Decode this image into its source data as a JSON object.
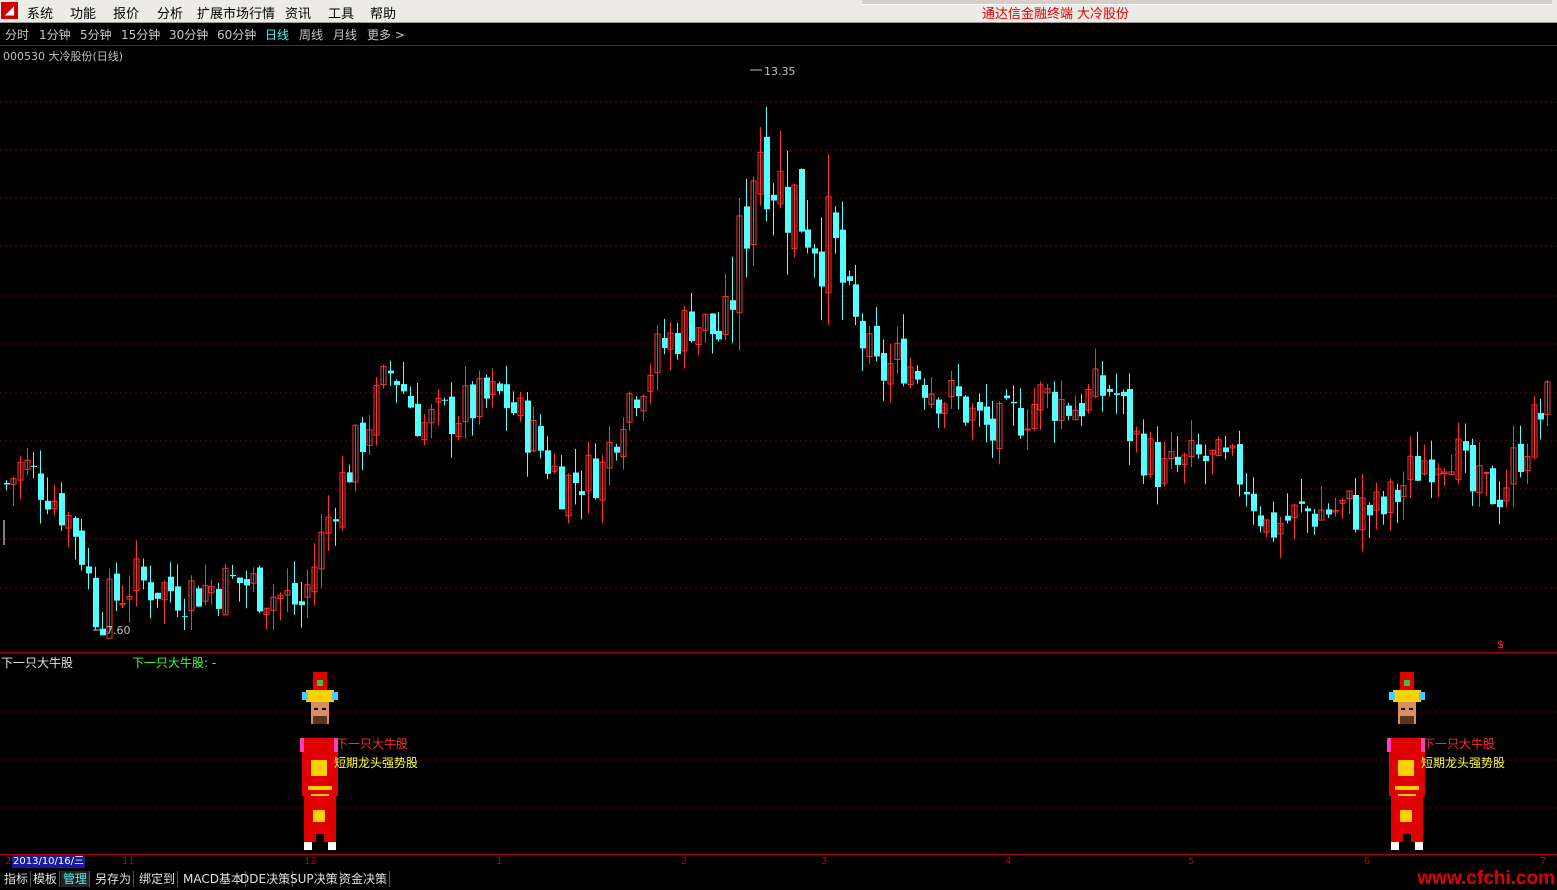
{
  "menu": {
    "items": [
      "系统",
      "功能",
      "报价",
      "分析",
      "扩展市场行情",
      "资讯",
      "工具",
      "帮助"
    ],
    "brand": "通达信金融终端",
    "stock_name": "大冷股份"
  },
  "periods": {
    "items": [
      "分时",
      "1分钟",
      "5分钟",
      "15分钟",
      "30分钟",
      "60分钟",
      "日线",
      "周线",
      "月线",
      "更多 >"
    ],
    "active": "日线"
  },
  "chart_header": {
    "title": "000530 大冷股份(日线)"
  },
  "chart_data": {
    "type": "candlestick",
    "max_label": "13.35",
    "min_label": "7.60",
    "ylim": [
      7.6,
      13.35
    ],
    "colors": {
      "up": "#ff3232",
      "down": "#54ffff"
    },
    "x_ticks": [
      "11",
      "12",
      "1",
      "2",
      "3",
      "4",
      "5",
      "6",
      "7"
    ]
  },
  "indicator": {
    "title": "下一只大牛股",
    "value_label": "下一只大牛股: -",
    "signal_text_1": "下一只大牛股",
    "signal_text_2": "短期龙头强势股",
    "money_symbol": "$"
  },
  "time_axis": {
    "prefix": "2",
    "cursor_date": "2013/10/16/三"
  },
  "bottom_tabs": [
    "指标",
    "模板",
    "管理",
    "另存为",
    "绑定到",
    "MACD基本",
    "DDE决策",
    "SUP决策",
    "资金决策"
  ],
  "bottom_selected": "管理",
  "watermark": "www.cfchi.com"
}
